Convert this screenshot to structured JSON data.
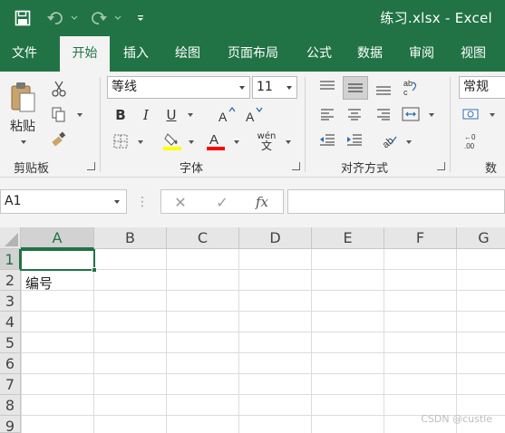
{
  "window": {
    "title": "练习.xlsx  -  Excel"
  },
  "quick_access": {
    "save_icon": "save-icon",
    "undo_icon": "undo-icon",
    "redo_icon": "redo-icon",
    "customize_icon": "customize-qat-icon"
  },
  "tabs": [
    {
      "label": "文件",
      "active": false
    },
    {
      "label": "开始",
      "active": true
    },
    {
      "label": "插入",
      "active": false
    },
    {
      "label": "绘图",
      "active": false
    },
    {
      "label": "页面布局",
      "active": false
    },
    {
      "label": "公式",
      "active": false
    },
    {
      "label": "数据",
      "active": false
    },
    {
      "label": "审阅",
      "active": false
    },
    {
      "label": "视图",
      "active": false
    }
  ],
  "ribbon": {
    "clipboard": {
      "paste_label": "粘贴",
      "group_label": "剪贴板"
    },
    "font": {
      "font_name": "等线",
      "font_size": "11",
      "group_label": "字体",
      "bold": "B",
      "italic": "I",
      "underline": "U",
      "fill_color": "#ffff00",
      "font_color": "#ff0000",
      "phonetic_top": "wén",
      "phonetic_bottom": "文"
    },
    "alignment": {
      "group_label": "对齐方式"
    },
    "number": {
      "format": "常规",
      "group_label": "数",
      "decimal_label": ".00\n→.0"
    }
  },
  "formula_bar": {
    "name_box": "A1",
    "cancel": "✕",
    "enter": "✓",
    "fx": "fx",
    "formula": ""
  },
  "sheet": {
    "columns": [
      "A",
      "B",
      "C",
      "D",
      "E",
      "F",
      "G"
    ],
    "rows": [
      "1",
      "2",
      "3",
      "4",
      "5",
      "6",
      "7",
      "8",
      "9"
    ],
    "selected_cell": "A1",
    "cells": {
      "A2": "编号"
    }
  },
  "watermark": "CSDN @custle",
  "colors": {
    "brand": "#217346",
    "ribbon_bg": "#f3f3f3"
  }
}
